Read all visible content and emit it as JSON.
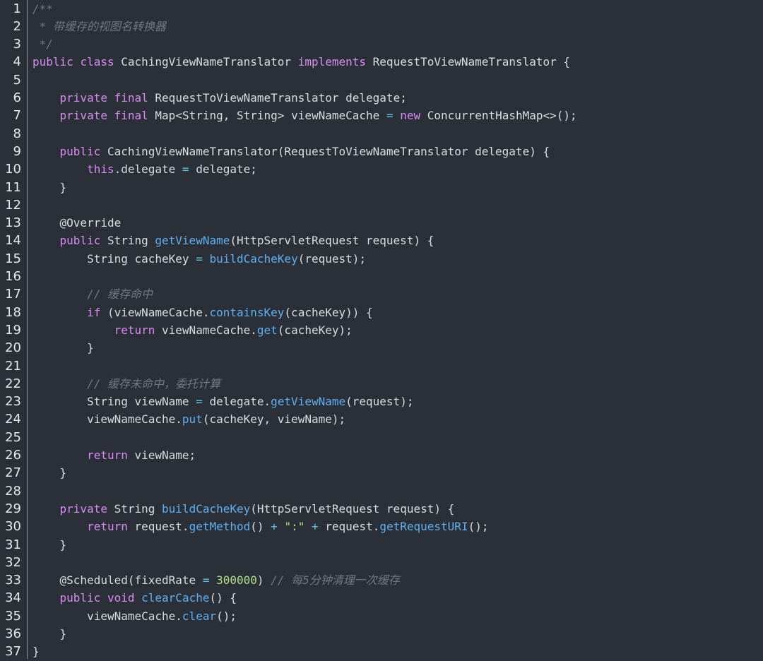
{
  "editor": {
    "language": "java",
    "lines": [
      {
        "n": "1",
        "indent": 0,
        "tokens": [
          {
            "t": "cm",
            "v": "/**"
          }
        ]
      },
      {
        "n": "2",
        "indent": 0,
        "tokens": [
          {
            "t": "cm",
            "v": " * 带缓存的视图名转换器"
          }
        ]
      },
      {
        "n": "3",
        "indent": 0,
        "tokens": [
          {
            "t": "cm",
            "v": " */"
          }
        ]
      },
      {
        "n": "4",
        "indent": 0,
        "tokens": [
          {
            "t": "kw",
            "v": "public"
          },
          {
            "t": "txt",
            "v": " "
          },
          {
            "t": "kw",
            "v": "class"
          },
          {
            "t": "txt",
            "v": " CachingViewNameTranslator "
          },
          {
            "t": "kw",
            "v": "implements"
          },
          {
            "t": "txt",
            "v": " RequestToViewNameTranslator {"
          }
        ]
      },
      {
        "n": "5",
        "indent": 0,
        "tokens": []
      },
      {
        "n": "6",
        "indent": 1,
        "tokens": [
          {
            "t": "kw",
            "v": "private"
          },
          {
            "t": "txt",
            "v": " "
          },
          {
            "t": "kw",
            "v": "final"
          },
          {
            "t": "txt",
            "v": " RequestToViewNameTranslator delegate;"
          }
        ]
      },
      {
        "n": "7",
        "indent": 1,
        "tokens": [
          {
            "t": "kw",
            "v": "private"
          },
          {
            "t": "txt",
            "v": " "
          },
          {
            "t": "kw",
            "v": "final"
          },
          {
            "t": "txt",
            "v": " Map<String, String> viewNameCache "
          },
          {
            "t": "op",
            "v": "="
          },
          {
            "t": "txt",
            "v": " "
          },
          {
            "t": "kw",
            "v": "new"
          },
          {
            "t": "txt",
            "v": " ConcurrentHashMap<>();"
          }
        ]
      },
      {
        "n": "8",
        "indent": 0,
        "tokens": []
      },
      {
        "n": "9",
        "indent": 1,
        "tokens": [
          {
            "t": "kw",
            "v": "public"
          },
          {
            "t": "txt",
            "v": " CachingViewNameTranslator(RequestToViewNameTranslator delegate) {"
          }
        ]
      },
      {
        "n": "10",
        "indent": 2,
        "tokens": [
          {
            "t": "kw",
            "v": "this"
          },
          {
            "t": "txt",
            "v": ".delegate "
          },
          {
            "t": "op",
            "v": "="
          },
          {
            "t": "txt",
            "v": " delegate;"
          }
        ]
      },
      {
        "n": "11",
        "indent": 1,
        "tokens": [
          {
            "t": "txt",
            "v": "}"
          }
        ]
      },
      {
        "n": "12",
        "indent": 0,
        "tokens": []
      },
      {
        "n": "13",
        "indent": 1,
        "tokens": [
          {
            "t": "ann",
            "v": "@Override"
          }
        ]
      },
      {
        "n": "14",
        "indent": 1,
        "tokens": [
          {
            "t": "kw",
            "v": "public"
          },
          {
            "t": "txt",
            "v": " String "
          },
          {
            "t": "fn",
            "v": "getViewName"
          },
          {
            "t": "txt",
            "v": "(HttpServletRequest request) {"
          }
        ]
      },
      {
        "n": "15",
        "indent": 2,
        "tokens": [
          {
            "t": "txt",
            "v": "String cacheKey "
          },
          {
            "t": "op",
            "v": "="
          },
          {
            "t": "txt",
            "v": " "
          },
          {
            "t": "fn",
            "v": "buildCacheKey"
          },
          {
            "t": "txt",
            "v": "(request);"
          }
        ]
      },
      {
        "n": "16",
        "indent": 0,
        "tokens": []
      },
      {
        "n": "17",
        "indent": 2,
        "tokens": [
          {
            "t": "cm",
            "v": "// 缓存命中"
          }
        ]
      },
      {
        "n": "18",
        "indent": 2,
        "tokens": [
          {
            "t": "kw",
            "v": "if"
          },
          {
            "t": "txt",
            "v": " (viewNameCache."
          },
          {
            "t": "fn",
            "v": "containsKey"
          },
          {
            "t": "txt",
            "v": "(cacheKey)) {"
          }
        ]
      },
      {
        "n": "19",
        "indent": 3,
        "tokens": [
          {
            "t": "kw",
            "v": "return"
          },
          {
            "t": "txt",
            "v": " viewNameCache."
          },
          {
            "t": "fn",
            "v": "get"
          },
          {
            "t": "txt",
            "v": "(cacheKey);"
          }
        ]
      },
      {
        "n": "20",
        "indent": 2,
        "tokens": [
          {
            "t": "txt",
            "v": "}"
          }
        ]
      },
      {
        "n": "21",
        "indent": 0,
        "tokens": []
      },
      {
        "n": "22",
        "indent": 2,
        "tokens": [
          {
            "t": "cm",
            "v": "// 缓存未命中，委托计算"
          }
        ]
      },
      {
        "n": "23",
        "indent": 2,
        "tokens": [
          {
            "t": "txt",
            "v": "String viewName "
          },
          {
            "t": "op",
            "v": "="
          },
          {
            "t": "txt",
            "v": " delegate."
          },
          {
            "t": "fn",
            "v": "getViewName"
          },
          {
            "t": "txt",
            "v": "(request);"
          }
        ]
      },
      {
        "n": "24",
        "indent": 2,
        "tokens": [
          {
            "t": "txt",
            "v": "viewNameCache."
          },
          {
            "t": "fn",
            "v": "put"
          },
          {
            "t": "txt",
            "v": "(cacheKey, viewName);"
          }
        ]
      },
      {
        "n": "25",
        "indent": 0,
        "tokens": []
      },
      {
        "n": "26",
        "indent": 2,
        "tokens": [
          {
            "t": "kw",
            "v": "return"
          },
          {
            "t": "txt",
            "v": " viewName;"
          }
        ]
      },
      {
        "n": "27",
        "indent": 1,
        "tokens": [
          {
            "t": "txt",
            "v": "}"
          }
        ]
      },
      {
        "n": "28",
        "indent": 0,
        "tokens": []
      },
      {
        "n": "29",
        "indent": 1,
        "tokens": [
          {
            "t": "kw",
            "v": "private"
          },
          {
            "t": "txt",
            "v": " String "
          },
          {
            "t": "fn",
            "v": "buildCacheKey"
          },
          {
            "t": "txt",
            "v": "(HttpServletRequest request) {"
          }
        ]
      },
      {
        "n": "30",
        "indent": 2,
        "tokens": [
          {
            "t": "kw",
            "v": "return"
          },
          {
            "t": "txt",
            "v": " request."
          },
          {
            "t": "fn",
            "v": "getMethod"
          },
          {
            "t": "txt",
            "v": "() "
          },
          {
            "t": "op",
            "v": "+"
          },
          {
            "t": "txt",
            "v": " "
          },
          {
            "t": "str",
            "v": "\":\""
          },
          {
            "t": "txt",
            "v": " "
          },
          {
            "t": "op",
            "v": "+"
          },
          {
            "t": "txt",
            "v": " request."
          },
          {
            "t": "fn",
            "v": "getRequestURI"
          },
          {
            "t": "txt",
            "v": "();"
          }
        ]
      },
      {
        "n": "31",
        "indent": 1,
        "tokens": [
          {
            "t": "txt",
            "v": "}"
          }
        ]
      },
      {
        "n": "32",
        "indent": 0,
        "tokens": []
      },
      {
        "n": "33",
        "indent": 1,
        "tokens": [
          {
            "t": "ann",
            "v": "@Scheduled"
          },
          {
            "t": "txt",
            "v": "(fixedRate "
          },
          {
            "t": "op",
            "v": "="
          },
          {
            "t": "txt",
            "v": " "
          },
          {
            "t": "num",
            "v": "300000"
          },
          {
            "t": "txt",
            "v": ") "
          },
          {
            "t": "cm",
            "v": "// 每5分钟清理一次缓存"
          }
        ]
      },
      {
        "n": "34",
        "indent": 1,
        "tokens": [
          {
            "t": "kw",
            "v": "public"
          },
          {
            "t": "txt",
            "v": " "
          },
          {
            "t": "kw",
            "v": "void"
          },
          {
            "t": "txt",
            "v": " "
          },
          {
            "t": "fn",
            "v": "clearCache"
          },
          {
            "t": "txt",
            "v": "() {"
          }
        ]
      },
      {
        "n": "35",
        "indent": 2,
        "tokens": [
          {
            "t": "txt",
            "v": "viewNameCache."
          },
          {
            "t": "fn",
            "v": "clear"
          },
          {
            "t": "txt",
            "v": "();"
          }
        ]
      },
      {
        "n": "36",
        "indent": 1,
        "tokens": [
          {
            "t": "txt",
            "v": "}"
          }
        ]
      },
      {
        "n": "37",
        "indent": 0,
        "tokens": [
          {
            "t": "txt",
            "v": "}"
          }
        ]
      }
    ]
  },
  "colors": {
    "background": "#2b3038",
    "keyword": "#d78cf0",
    "function": "#5fb0f2",
    "number": "#b4e08a",
    "string": "#b4e08a",
    "operator": "#5fc4e0",
    "comment": "#6f7884",
    "text": "#d8dde3",
    "line_number": "#e6e8eb"
  }
}
